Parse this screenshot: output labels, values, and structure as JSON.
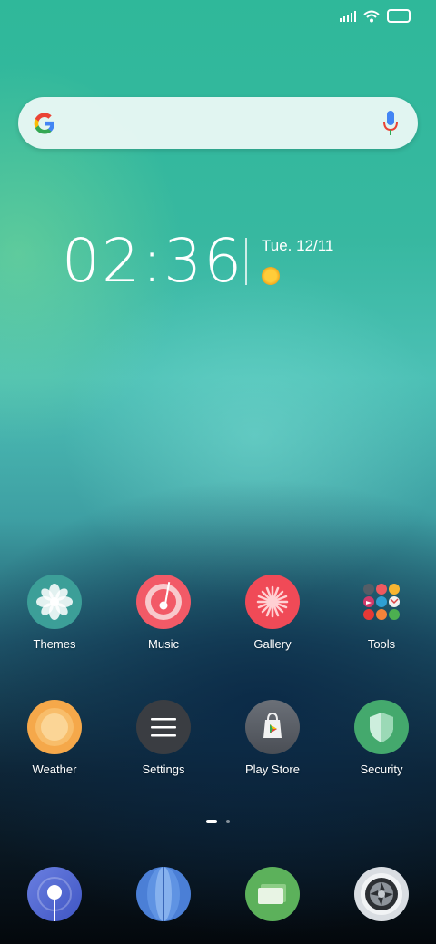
{
  "status_bar": {
    "signal_icon": "signal-bars-icon",
    "wifi_icon": "wifi-icon",
    "battery_icon": "battery-icon"
  },
  "search": {
    "logo_icon": "google-g-icon",
    "voice_icon": "mic-icon"
  },
  "clock": {
    "time": "02:36",
    "date": "Tue. 12/11",
    "weather_icon": "sun-icon"
  },
  "apps_row1": [
    {
      "label": "Themes",
      "icon": "themes-icon",
      "color": "#3c9f98"
    },
    {
      "label": "Music",
      "icon": "music-icon",
      "color": "#f25a67"
    },
    {
      "label": "Gallery",
      "icon": "gallery-icon",
      "color": "#f04a57"
    },
    {
      "label": "Tools",
      "icon": "tools-folder-icon",
      "color": "transparent"
    }
  ],
  "apps_row2": [
    {
      "label": "Weather",
      "icon": "weather-icon",
      "color": "#f5a84a"
    },
    {
      "label": "Settings",
      "icon": "settings-icon",
      "color": "#3a3d42"
    },
    {
      "label": "Play Store",
      "icon": "play-store-icon",
      "color": "#5b6068"
    },
    {
      "label": "Security",
      "icon": "security-icon",
      "color": "#44a96d"
    }
  ],
  "page_indicator": {
    "pages": 2,
    "current": 1
  },
  "dock": [
    {
      "icon": "phone-icon",
      "color": "#4d67d6"
    },
    {
      "icon": "browser-icon",
      "color": "#4b7fd6"
    },
    {
      "icon": "messages-icon",
      "color": "#5cb15b"
    },
    {
      "icon": "camera-icon",
      "color": "#d9dde2"
    }
  ]
}
